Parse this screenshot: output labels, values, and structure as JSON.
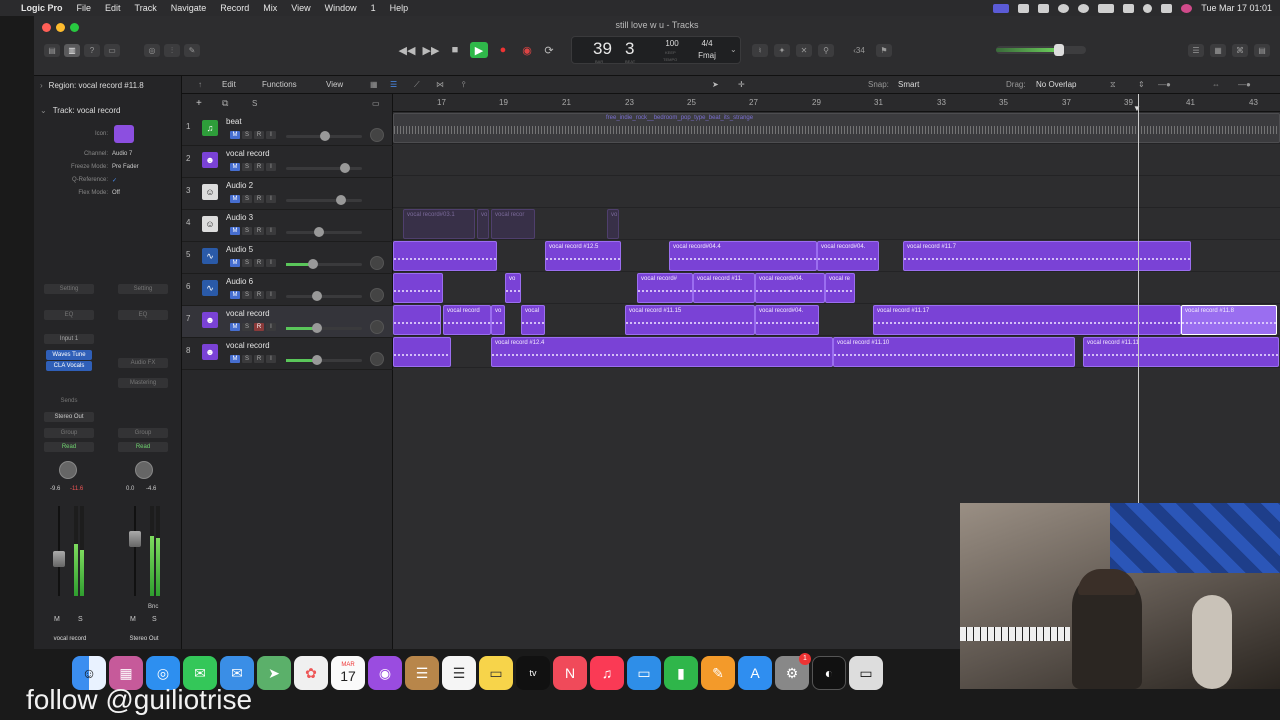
{
  "menubar": {
    "app": "Logic Pro",
    "items": [
      "File",
      "Edit",
      "Track",
      "Navigate",
      "Record",
      "Mix",
      "View",
      "Window",
      "1",
      "Help"
    ],
    "clock": "Tue Mar 17  01:01"
  },
  "window": {
    "title": "still love w u - Tracks"
  },
  "lcd": {
    "bar": "39",
    "beat": "3",
    "bar_label": "BAR",
    "beat_label": "BEAT",
    "tempo": "100",
    "tempo_label": "KEEP",
    "tempo_sub": "TEMPO",
    "signature": "4/4",
    "key": "Fmaj"
  },
  "toolbar": {
    "count_in": "‹34"
  },
  "inspector": {
    "region_label": "Region: vocal record #11.8",
    "track_label": "Track:  vocal record",
    "icon_label": "Icon:",
    "channel_label": "Channel:",
    "channel_value": "Audio 7",
    "freeze_label": "Freeze Mode:",
    "freeze_value": "Pre Fader",
    "qref_label": "Q-Reference:",
    "qref_value": "✓",
    "flex_label": "Flex Mode:",
    "flex_value": "Off",
    "strip1": {
      "setting": "Setting",
      "eq": "EQ",
      "input": "Input 1",
      "plugin1": "Waves Tune",
      "plugin2": "CLA Vocals",
      "sends": "Sends",
      "output": "Stereo Out",
      "group": "Group",
      "automation": "Read",
      "pan_value": "-9.6",
      "peak_value": "-11.6",
      "name": "vocal record"
    },
    "strip2": {
      "setting": "Setting",
      "eq": "EQ",
      "audiofx": "Audio FX",
      "mastering": "Mastering",
      "group": "Group",
      "automation": "Read",
      "pan_value": "0.0",
      "peak_value": "-4.6",
      "bnc": "Bnc",
      "name": "Stereo Out"
    }
  },
  "track_toolbar": {
    "edit": "Edit",
    "functions": "Functions",
    "view": "View",
    "snap_label": "Snap:",
    "snap_value": "Smart",
    "drag_label": "Drag:",
    "drag_value": "No Overlap"
  },
  "ruler": [
    "17",
    "19",
    "21",
    "23",
    "25",
    "27",
    "29",
    "31",
    "33",
    "35",
    "37",
    "39",
    "41",
    "43"
  ],
  "tracks": [
    {
      "num": "1",
      "name": "beat",
      "icon": "music-note-icon",
      "color": "#2e9e3a"
    },
    {
      "num": "2",
      "name": "vocal record",
      "icon": "person-icon",
      "color": "#7a42d6"
    },
    {
      "num": "3",
      "name": "Audio 2",
      "icon": "face-icon",
      "color": "#c9c9c9"
    },
    {
      "num": "4",
      "name": "Audio 3",
      "icon": "face-icon",
      "color": "#c9c9c9"
    },
    {
      "num": "5",
      "name": "Audio 5",
      "icon": "waveform-icon",
      "color": "#3a7bd5"
    },
    {
      "num": "6",
      "name": "Audio 6",
      "icon": "waveform-icon",
      "color": "#3a7bd5"
    },
    {
      "num": "7",
      "name": "vocal record",
      "icon": "person-icon",
      "color": "#7a42d6"
    },
    {
      "num": "8",
      "name": "vocal record",
      "icon": "person-icon",
      "color": "#7a42d6"
    }
  ],
  "regions": {
    "beat": "free_indie_rock__bedroom_pop_type_beat_its_strange",
    "lane4": [
      "vocal record#03.1",
      "vo",
      "vocal recor",
      "vo"
    ],
    "lane5": [
      "vocal record #12.5",
      "vocal record#04.4",
      "vocal record#04.",
      "vocal record #11.7"
    ],
    "lane6": [
      "vo",
      "vocal record#",
      "vocal record #11.",
      "vocal record#04.",
      "vocal re"
    ],
    "lane7": [
      "vocal record",
      "vo",
      "vocal",
      "vocal record #11.15",
      "vocal record#04.",
      "vocal record #11.17",
      "vocal record #11.8"
    ],
    "lane8": [
      "vocal record #12.4",
      "vocal record #11.10",
      "vocal record #11.11"
    ]
  },
  "dock": {
    "calendar_month": "MAR",
    "calendar_day": "17",
    "badge": "1"
  },
  "caption": "follow @guiliotrise"
}
